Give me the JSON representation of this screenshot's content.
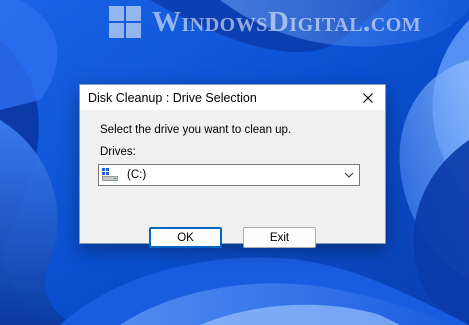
{
  "watermark": {
    "text": "WindowsDigital.com"
  },
  "dialog": {
    "title": "Disk Cleanup : Drive Selection",
    "prompt": "Select the drive you want to clean up.",
    "drives_label": "Drives:",
    "drive_selected": "(C:)",
    "ok_label": "OK",
    "exit_label": "Exit"
  },
  "icons": {
    "close": "close-icon",
    "drive": "hard-drive-icon",
    "dropdown": "chevron-down-icon",
    "logo": "windows-logo-icon"
  },
  "colors": {
    "wallpaper_base": "#0a55d8",
    "wallpaper_light": "#4c8cf2",
    "dialog_bg": "#f0f0f0",
    "default_button_border": "#0067c0"
  }
}
